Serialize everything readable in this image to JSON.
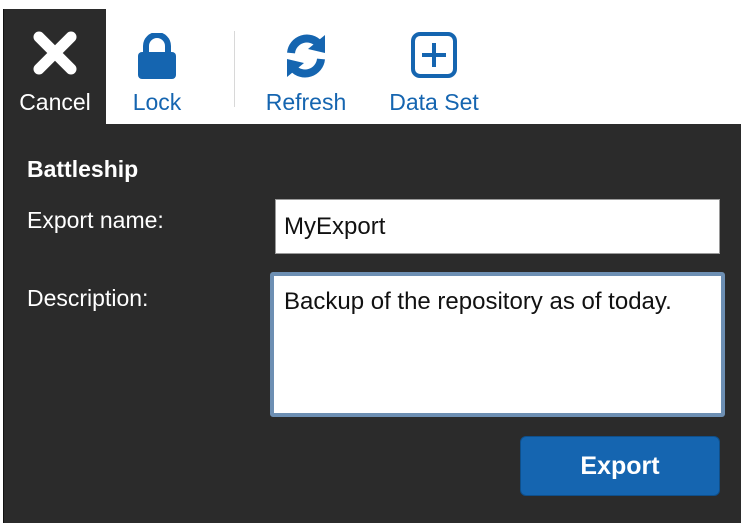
{
  "toolbar": {
    "cancel": {
      "label": "Cancel",
      "icon": "close-icon"
    },
    "lock": {
      "label": "Lock",
      "icon": "lock-icon"
    },
    "refresh": {
      "label": "Refresh",
      "icon": "refresh-icon"
    },
    "data_set": {
      "label": "Data Set",
      "icon": "add-box-icon"
    }
  },
  "form": {
    "title": "Battleship",
    "export_name_label": "Export name:",
    "export_name_value": "MyExport",
    "description_label": "Description:",
    "description_value": "Backup of the repository as of today.",
    "export_button": "Export"
  },
  "colors": {
    "panel_background": "#2b2b2b",
    "accent_blue": "#1565b0",
    "focus_border": "#6d8fb3"
  }
}
